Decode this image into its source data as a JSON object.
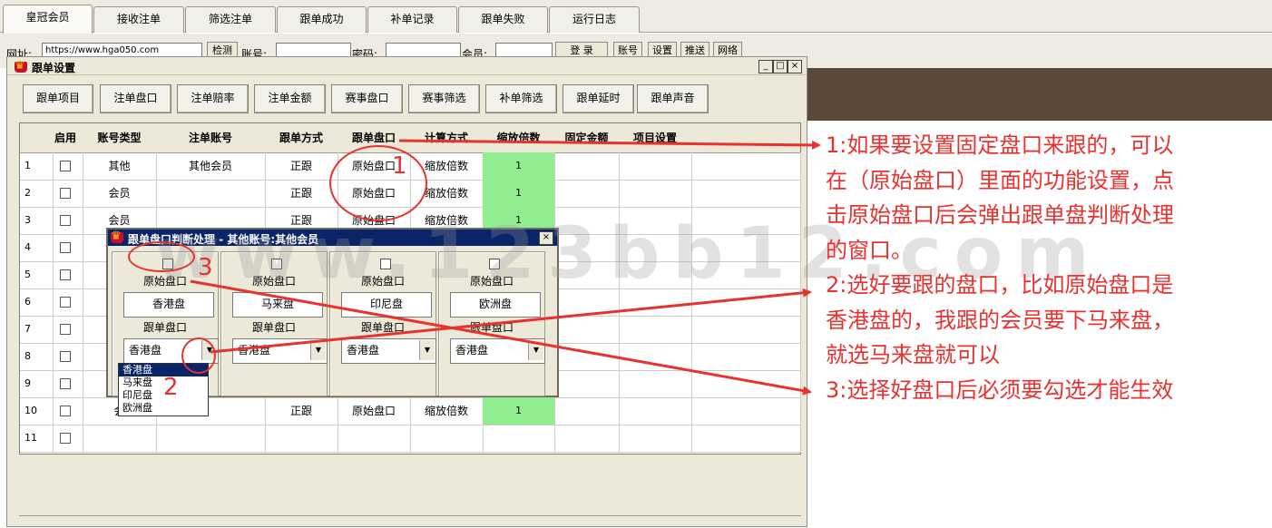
{
  "tabs": [
    {
      "label": "皇冠会员",
      "active": true
    },
    {
      "label": "接收注单",
      "active": false
    },
    {
      "label": "筛选注单",
      "active": false
    },
    {
      "label": "跟单成功",
      "active": false
    },
    {
      "label": "补单记录",
      "active": false
    },
    {
      "label": "跟单失败",
      "active": false
    },
    {
      "label": "运行日志",
      "active": false
    }
  ],
  "toolbar": {
    "url_label": "网址:",
    "url_value": "https://www.hga050.com",
    "check_button": "检测",
    "account_label": "账号:",
    "password_label": "密码:",
    "member_label": "会员:",
    "login_button": "登 录",
    "buttons": [
      "账号",
      "设置",
      "推送",
      "网络"
    ]
  },
  "window": {
    "title": "跟单设置",
    "buttons": [
      "跟单项目",
      "注单盘口",
      "注单赔率",
      "注单金额",
      "赛事盘口",
      "赛事筛选",
      "补单筛选",
      "跟单延时",
      "跟单声音"
    ]
  },
  "grid": {
    "headers": [
      "启用",
      "账号类型",
      "注单账号",
      "跟单方式",
      "跟单盘口",
      "计算方式",
      "缩放倍数",
      "固定金额",
      "项目设置"
    ],
    "rows": [
      {
        "n": "1",
        "type": "其他",
        "account": "其他会员",
        "mode": "正跟",
        "pankou": "原始盘口",
        "calc": "缩放倍数",
        "scale": "1"
      },
      {
        "n": "2",
        "type": "会员",
        "account": "",
        "mode": "正跟",
        "pankou": "原始盘口",
        "calc": "缩放倍数",
        "scale": "1"
      },
      {
        "n": "3",
        "type": "会员",
        "account": "",
        "mode": "正跟",
        "pankou": "原始盘口",
        "calc": "缩放倍数",
        "scale": "1"
      },
      {
        "n": "4",
        "type": "",
        "account": "",
        "mode": "",
        "pankou": "",
        "calc": "",
        "scale": ""
      },
      {
        "n": "5",
        "type": "",
        "account": "",
        "mode": "",
        "pankou": "",
        "calc": "",
        "scale": ""
      },
      {
        "n": "6",
        "type": "",
        "account": "",
        "mode": "",
        "pankou": "",
        "calc": "",
        "scale": ""
      },
      {
        "n": "7",
        "type": "",
        "account": "",
        "mode": "",
        "pankou": "",
        "calc": "",
        "scale": ""
      },
      {
        "n": "8",
        "type": "",
        "account": "",
        "mode": "",
        "pankou": "",
        "calc": "",
        "scale": ""
      },
      {
        "n": "9",
        "type": "",
        "account": "",
        "mode": "",
        "pankou": "",
        "calc": "",
        "scale": ""
      },
      {
        "n": "10",
        "type": "会",
        "account": "",
        "mode": "正跟",
        "pankou": "原始盘口",
        "calc": "缩放倍数",
        "scale": "1"
      },
      {
        "n": "11",
        "type": "",
        "account": "",
        "mode": "",
        "pankou": "",
        "calc": "",
        "scale": ""
      }
    ]
  },
  "dialog": {
    "title": "跟单盘口判断处理 - 其他账号:其他会员",
    "groups": [
      {
        "label": "原始盘口",
        "value": "香港盘",
        "sel_label": "跟单盘口",
        "sel_value": "香港盘"
      },
      {
        "label": "原始盘口",
        "value": "马来盘",
        "sel_label": "跟单盘口",
        "sel_value": "香港盘"
      },
      {
        "label": "原始盘口",
        "value": "印尼盘",
        "sel_label": "跟单盘口",
        "sel_value": "香港盘"
      },
      {
        "label": "原始盘口",
        "value": "欧洲盘",
        "sel_label": "跟单盘口",
        "sel_value": "香港盘"
      }
    ],
    "options": [
      "香港盘",
      "马来盘",
      "印尼盘",
      "欧洲盘"
    ]
  },
  "annotations": {
    "lines": [
      "1:如果要设置固定盘口来跟的，可以",
      "在（原始盘口）里面的功能设置，点",
      "击原始盘口后会弹出跟单盘判断处理",
      "的窗口。",
      "2:选好要跟的盘口，比如原始盘口是",
      "香港盘的，我跟的会员要下马来盘，",
      "就选马来盘就可以",
      "3:选择好盘口后必须要勾选才能生效"
    ],
    "num1": "1",
    "num2": "2",
    "num3": "3",
    "color": "#e8322f"
  },
  "watermark": "www.123bb12.com"
}
